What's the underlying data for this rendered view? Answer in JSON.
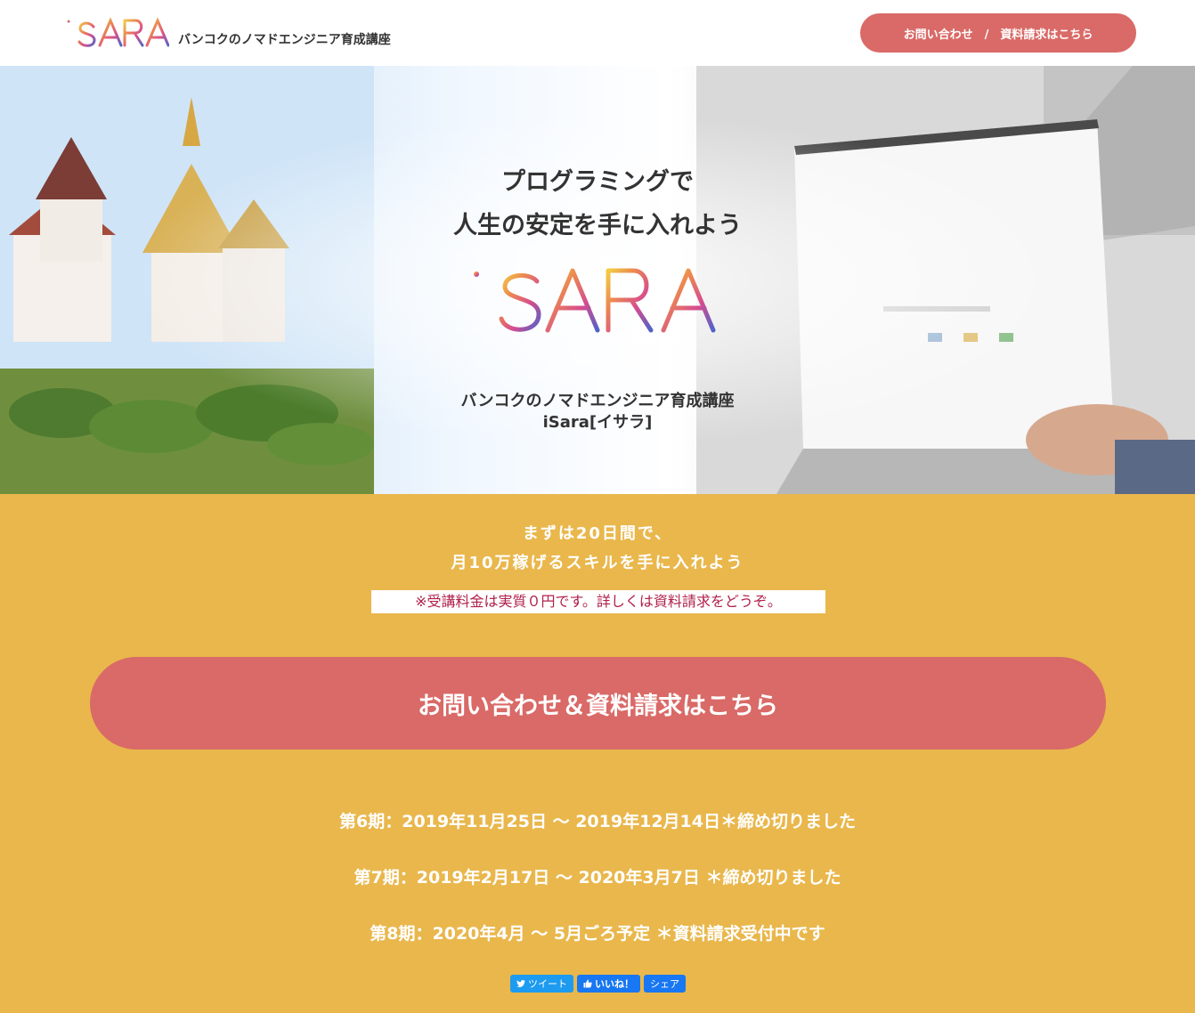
{
  "header": {
    "brand": "iSARA",
    "tagline": "バンコクのノマドエンジニア育成講座",
    "cta_label": "お問い合わせ　/　資料請求はこちら"
  },
  "hero": {
    "headline_line1": "プログラミングで",
    "headline_line2": "人生の安定を手に入れよう",
    "logo_text": "iSARA",
    "sub_line1": "バンコクのノマドエンジニア育成講座",
    "sub_line2": "iSara[イサラ]"
  },
  "cta_section": {
    "offer_line1": "まずは20日間で、",
    "offer_line2": "月10万稼げるスキルを手に入れよう",
    "notice": "※受講料金は実質０円です。詳しくは資料請求をどうぞ。",
    "main_cta": "お問い合わせ＆資料請求はこちら",
    "terms": [
      "第6期：2019年11月25日 〜 2019年12月14日＊締め切りました",
      "第7期：2019年2月17日 〜 2020年3月7日 ＊締め切りました",
      "第8期：2020年4月 〜 5月ごろ予定 ＊資料請求受付中です"
    ]
  },
  "share": {
    "tweet_label": "ツイート",
    "like_label": "いいね！",
    "share_label": "シェア"
  },
  "colors": {
    "accent": "#d96a67",
    "section_bg": "#e9b74c",
    "notice_text": "#b0204a",
    "twitter_blue": "#1d9bf0",
    "facebook_blue": "#1877f2"
  },
  "icons": [
    "twitter-bird-icon",
    "thumbs-up-icon"
  ]
}
